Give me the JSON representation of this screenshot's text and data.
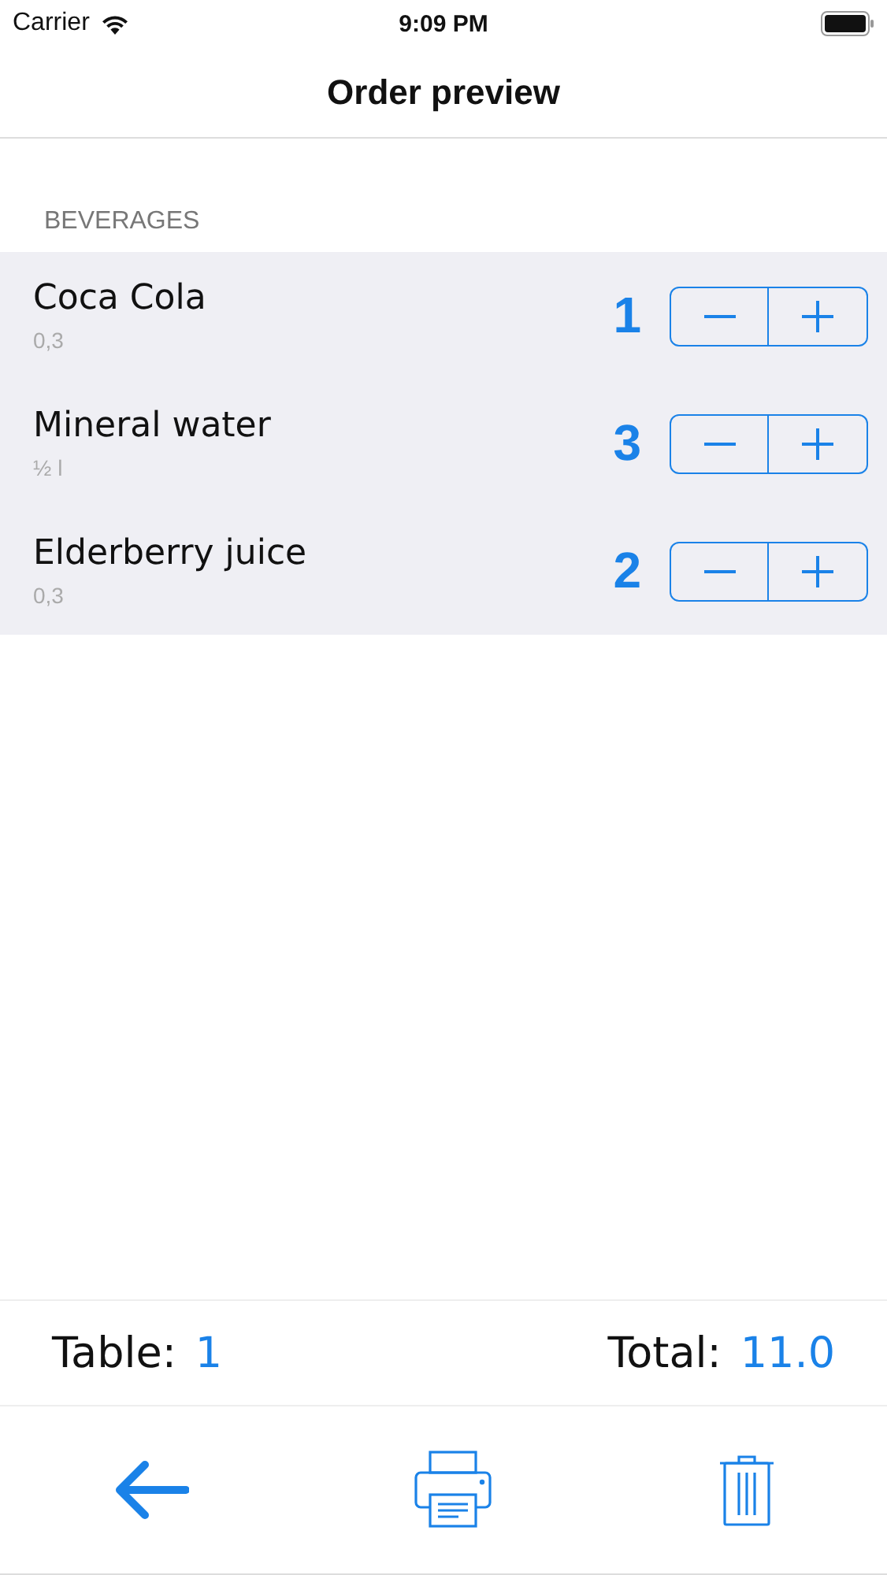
{
  "status_bar": {
    "carrier": "Carrier",
    "time": "9:09 PM"
  },
  "nav": {
    "title": "Order preview"
  },
  "section": {
    "header": "BEVERAGES",
    "items": [
      {
        "name": "Coca Cola",
        "size": "0,3",
        "quantity": "1"
      },
      {
        "name": "Mineral water",
        "size": "½ l",
        "quantity": "3"
      },
      {
        "name": "Elderberry juice",
        "size": "0,3",
        "quantity": "2"
      }
    ]
  },
  "summary": {
    "table_label": "Table:",
    "table_value": "1",
    "total_label": "Total:",
    "total_value": "11.0"
  },
  "toolbar": [
    {
      "kind": "back"
    },
    {
      "kind": "print"
    },
    {
      "kind": "delete"
    }
  ]
}
